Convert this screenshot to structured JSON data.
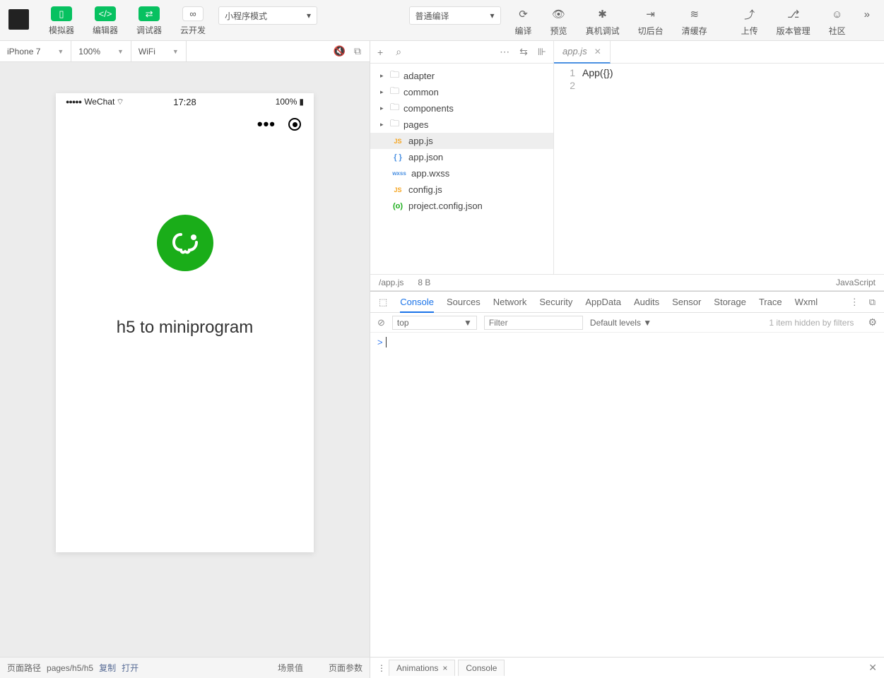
{
  "toolbar": {
    "simulator": "模拟器",
    "editor": "编辑器",
    "debugger": "调试器",
    "cloud": "云开发",
    "mode": "小程序模式",
    "translate": "普通编译",
    "compile": "编译",
    "preview": "预览",
    "remote": "真机调试",
    "background": "切后台",
    "clear_cache": "清缓存",
    "upload": "上传",
    "version": "版本管理",
    "community": "社区"
  },
  "simbar": {
    "device": "iPhone 7",
    "zoom": "100%",
    "network": "WiFi"
  },
  "phone": {
    "carrier": "WeChat",
    "time": "17:28",
    "battery": "100%",
    "title": "h5 to miniprogram"
  },
  "footer": {
    "path_label": "页面路径",
    "path": "pages/h5/h5",
    "copy": "复制",
    "open": "打开",
    "scene": "场景值",
    "params": "页面参数"
  },
  "tree": {
    "folders": [
      "adapter",
      "common",
      "components",
      "pages"
    ],
    "files": [
      {
        "name": "app.js",
        "type": "js",
        "sel": true
      },
      {
        "name": "app.json",
        "type": "json"
      },
      {
        "name": "app.wxss",
        "type": "wxss"
      },
      {
        "name": "config.js",
        "type": "js"
      },
      {
        "name": "project.config.json",
        "type": "cfg"
      }
    ]
  },
  "editor": {
    "tab": "app.js",
    "lines": [
      "1",
      "2"
    ],
    "code": "App({})",
    "status_path": "/app.js",
    "status_size": "8 B",
    "status_lang": "JavaScript"
  },
  "devtools": {
    "tabs": [
      "Console",
      "Sources",
      "Network",
      "Security",
      "AppData",
      "Audits",
      "Sensor",
      "Storage",
      "Trace",
      "Wxml"
    ],
    "context": "top",
    "filter_placeholder": "Filter",
    "levels": "Default levels ▼",
    "hidden": "1 item hidden by filters",
    "prompt": ">"
  },
  "drawer": {
    "animations": "Animations",
    "console": "Console"
  }
}
